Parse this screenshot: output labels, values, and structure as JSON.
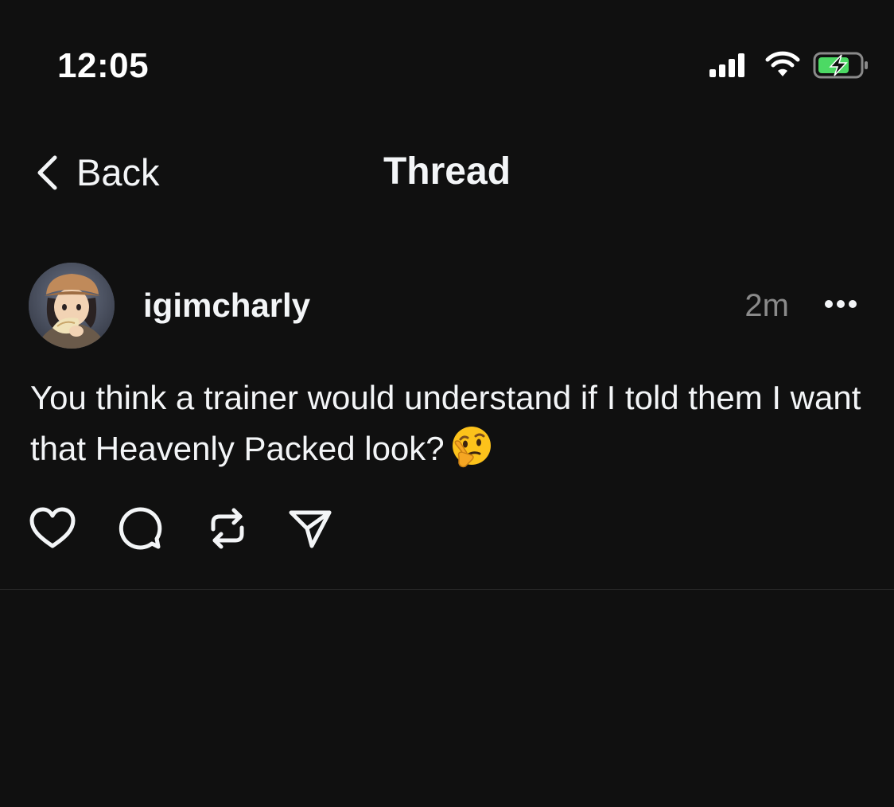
{
  "status_bar": {
    "time": "12:05",
    "icons": [
      "cellular-signal-icon",
      "wifi-icon",
      "battery-charging-icon"
    ],
    "battery_color": "#4cd964"
  },
  "nav": {
    "back_label": "Back",
    "title": "Thread"
  },
  "post": {
    "username": "igimcharly",
    "timestamp": "2m",
    "text": "You think a trainer would understand if I told them I want that Heavenly Packed look?",
    "emoji": "thinking-face-emoji",
    "actions": [
      "heart-icon",
      "comment-icon",
      "repost-icon",
      "share-icon"
    ]
  },
  "colors": {
    "background": "#101010",
    "text": "#f3f5f7",
    "muted": "#8a8a8a",
    "divider": "#2b2b2b"
  }
}
